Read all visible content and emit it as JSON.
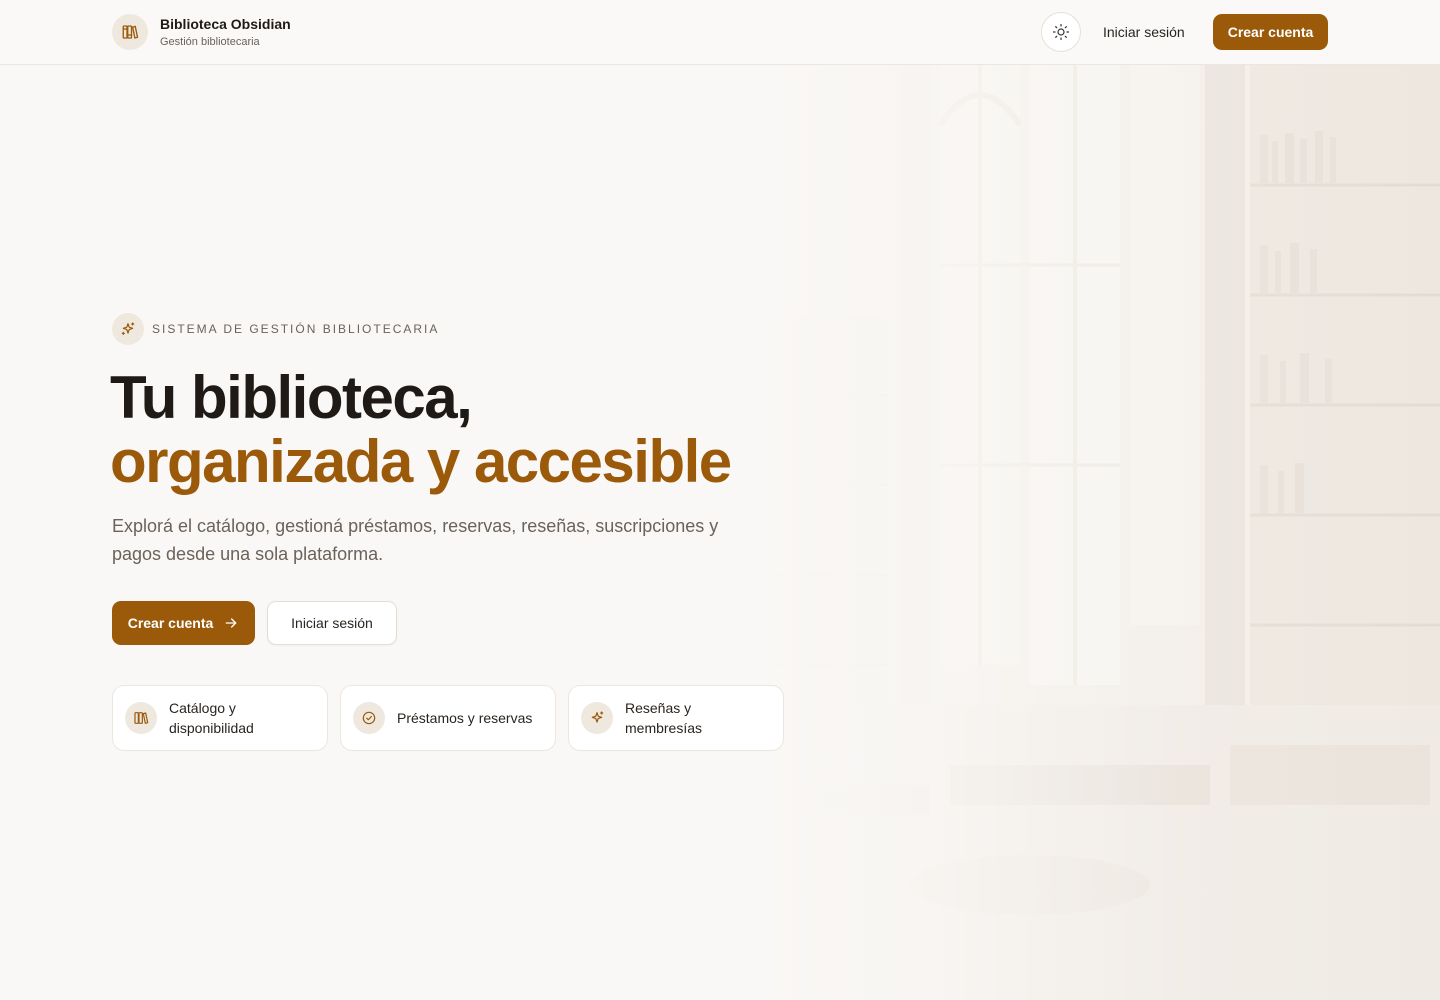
{
  "header": {
    "brand_title": "Biblioteca Obsidian",
    "brand_subtitle": "Gestión bibliotecaria",
    "brand_icon": "books-icon",
    "theme_toggle_icon": "sun-icon",
    "login_label": "Iniciar sesión",
    "signup_label": "Crear cuenta"
  },
  "hero": {
    "eyebrow_icon": "sparkles-icon",
    "eyebrow": "SISTEMA DE GESTIÓN BIBLIOTECARIA",
    "title_line1": "Tu biblioteca,",
    "title_line2": "organizada y accesible",
    "description": "Explorá el catálogo, gestioná préstamos, reservas, reseñas, suscripciones y pagos desde una sola plataforma.",
    "primary_cta": "Crear cuenta",
    "primary_cta_icon": "arrow-right-icon",
    "secondary_cta": "Iniciar sesión"
  },
  "features": [
    {
      "icon": "books-icon",
      "label_line1": "Catálogo y",
      "label_line2": "disponibilidad"
    },
    {
      "icon": "check-circle-icon",
      "label_line1": "Préstamos y reservas",
      "label_line2": ""
    },
    {
      "icon": "sparkles-icon",
      "label_line1": "Reseñas y",
      "label_line2": "membresías"
    }
  ],
  "colors": {
    "accent": "#9a5a0a",
    "background": "#faf8f6",
    "text": "#1f1a16",
    "muted": "#6b625a",
    "chip": "#efe8df"
  }
}
